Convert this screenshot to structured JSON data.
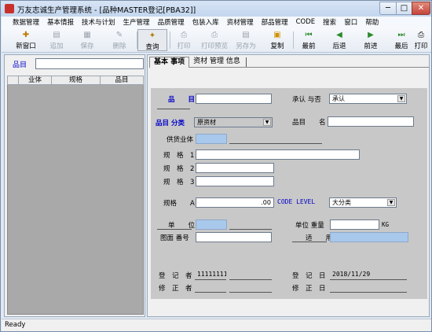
{
  "window": {
    "title": "万友志诚生产管理系统 - [品种MASTER登记[PBA32]]",
    "min": "─",
    "max": "□",
    "close": "✕"
  },
  "menu": [
    "数据管理",
    "基本情报",
    "技术与计划",
    "生产管理",
    "品质管理",
    "包装入库",
    "资材管理",
    "部品管理",
    "CODE",
    "搜索",
    "窗口",
    "帮助"
  ],
  "toolbar": {
    "buttons": [
      {
        "label": "新窗口",
        "icon": "new-window-icon",
        "glyph": "✚",
        "enabled": true
      },
      {
        "label": "追加",
        "icon": "add-icon",
        "glyph": "▤",
        "enabled": false
      },
      {
        "label": "保存",
        "icon": "save-icon",
        "glyph": "▦",
        "enabled": false
      },
      {
        "label": "删除",
        "icon": "delete-icon",
        "glyph": "✎",
        "enabled": false
      },
      {
        "label": "查询",
        "icon": "query-icon",
        "glyph": "✦",
        "enabled": true,
        "active": true
      },
      {
        "label": "打印",
        "icon": "print-icon",
        "glyph": "⎙",
        "enabled": false
      },
      {
        "label": "打印预览",
        "icon": "print-preview-icon",
        "glyph": "⎙",
        "enabled": false
      },
      {
        "label": "另存为",
        "icon": "save-as-icon",
        "glyph": "▤",
        "enabled": false
      },
      {
        "label": "复制",
        "icon": "copy-icon",
        "glyph": "▣",
        "enabled": true
      },
      {
        "label": "最前",
        "icon": "first-icon",
        "glyph": "⏮",
        "enabled": true
      },
      {
        "label": "后退",
        "icon": "back-icon",
        "glyph": "◀",
        "enabled": true
      },
      {
        "label": "前进",
        "icon": "forward-icon",
        "glyph": "▶",
        "enabled": true
      },
      {
        "label": "最后",
        "icon": "last-icon",
        "glyph": "⏭",
        "enabled": true
      },
      {
        "label": "打印",
        "icon": "print-icon",
        "glyph": "⎙",
        "enabled": true
      }
    ]
  },
  "left": {
    "search_label": "品目",
    "search_value": "",
    "columns": [
      "业体",
      "规格",
      "品目"
    ]
  },
  "tabs": [
    "基本 事项",
    "资材 管理 信息"
  ],
  "form": {
    "item_label": "品　　目",
    "approve_label": "承认  与否",
    "approve_value": "承认",
    "category_label": "品目 分类",
    "category_value": "原资材",
    "item_name_label": "品目　　名",
    "supplier_label": "供货业体",
    "spec1_label": "规　格　1",
    "spec2_label": "规　格　2",
    "spec3_label": "规　格　3",
    "specA_label": "规格　　A",
    "specA_value": ".00",
    "code_level_label": "CODE LEVEL",
    "code_level_value": "大分类",
    "unit_label": "单　　位",
    "unit_weight_label": "单位 重量",
    "unit_weight_unit": "KG",
    "drawing_label": "图面 番号",
    "usage_label": "适　　用",
    "registrar_label": "登　记　者",
    "registrar_value": "11111111",
    "reg_date_label": "登　记　日",
    "reg_date_value": "2018/11/29",
    "editor_label": "修　正　者",
    "edit_date_label": "修　正　日"
  },
  "status": "Ready"
}
